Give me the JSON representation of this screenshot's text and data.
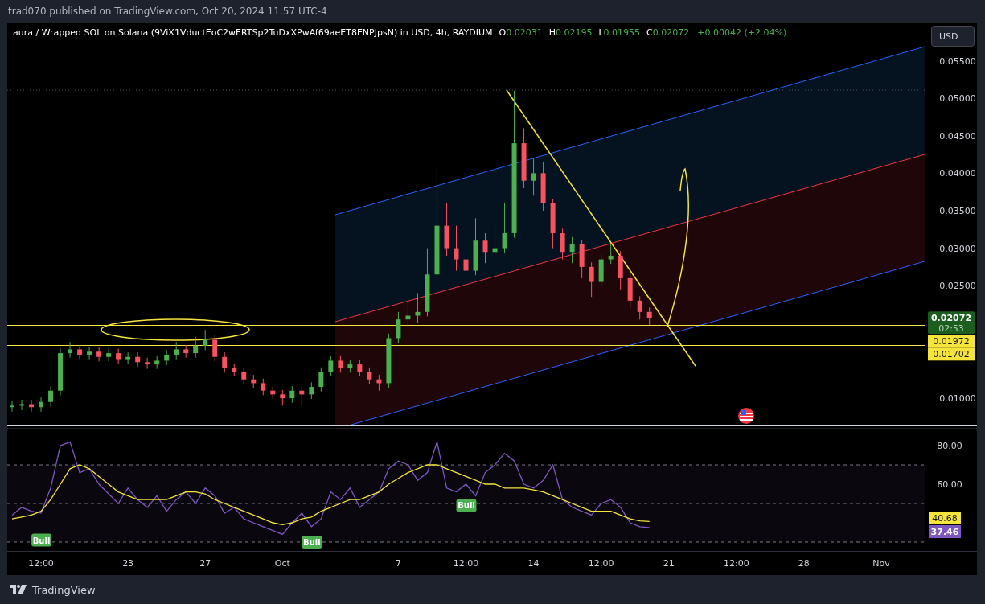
{
  "publish_line": "trad070 published on TradingView.com, Oct 20, 2024 11:57 UTC-4",
  "legend": {
    "title": "aura / Wrapped SOL on Solana (9ViX1VductEoC2wERTSp2TuDxXPwAf69aeET8ENPJpsN) in USD, 4h, RAYDIUM",
    "values": [
      {
        "key": "O",
        "value": "0.02031"
      },
      {
        "key": "H",
        "value": "0.02195"
      },
      {
        "key": "L",
        "value": "0.01955"
      },
      {
        "key": "C",
        "value": "0.02072"
      }
    ],
    "change": "+0.00042 (+2.04%)"
  },
  "currency_button": "USD",
  "price_chart": {
    "chart_data": {
      "type": "candlestick",
      "ylim": [
        0.00625,
        0.0601
      ],
      "categories": [
        null,
        null,
        null,
        null,
        null,
        null,
        null,
        null,
        null,
        null,
        null,
        null,
        null,
        null,
        null,
        null,
        null,
        null,
        null,
        null,
        null,
        null,
        null,
        null,
        null,
        null,
        null,
        null,
        null,
        null,
        null,
        null,
        null,
        null,
        null,
        null,
        null,
        null,
        null,
        null,
        null,
        null,
        null,
        null,
        null,
        null,
        null,
        null,
        null,
        null,
        null,
        null,
        null,
        null,
        null,
        null,
        null,
        null,
        null,
        null,
        null,
        null,
        null,
        null,
        null,
        null,
        null,
        null,
        null,
        null,
        null,
        null,
        null,
        null,
        null,
        null,
        null,
        null,
        null,
        null,
        null,
        null,
        null,
        null,
        null,
        null,
        null,
        null,
        null,
        null,
        null,
        null,
        null,
        null,
        null
      ],
      "ohlc": [
        [
          0.0088,
          0.0096,
          0.0082,
          0.009
        ],
        [
          0.009,
          0.0098,
          0.0084,
          0.0092
        ],
        [
          0.0092,
          0.0098,
          0.0082,
          0.0088
        ],
        [
          0.0088,
          0.0101,
          0.0082,
          0.0095
        ],
        [
          0.0095,
          0.0116,
          0.0089,
          0.011
        ],
        [
          0.011,
          0.0166,
          0.0104,
          0.016
        ],
        [
          0.016,
          0.0175,
          0.0154,
          0.0165
        ],
        [
          0.0165,
          0.0171,
          0.0152,
          0.0158
        ],
        [
          0.0158,
          0.0168,
          0.0152,
          0.0162
        ],
        [
          0.0162,
          0.0168,
          0.0149,
          0.0155
        ],
        [
          0.0155,
          0.0166,
          0.0149,
          0.016
        ],
        [
          0.016,
          0.0166,
          0.0146,
          0.0152
        ],
        [
          0.0152,
          0.0161,
          0.0146,
          0.0155
        ],
        [
          0.0155,
          0.0161,
          0.0142,
          0.0148
        ],
        [
          0.0148,
          0.0154,
          0.0139,
          0.0145
        ],
        [
          0.0145,
          0.0156,
          0.0139,
          0.015
        ],
        [
          0.015,
          0.0164,
          0.0144,
          0.0158
        ],
        [
          0.0158,
          0.0175,
          0.0152,
          0.0165
        ],
        [
          0.0165,
          0.0171,
          0.0154,
          0.016
        ],
        [
          0.016,
          0.0182,
          0.0154,
          0.017
        ],
        [
          0.017,
          0.0191,
          0.0164,
          0.0178
        ],
        [
          0.0178,
          0.0184,
          0.0149,
          0.0155
        ],
        [
          0.0155,
          0.0161,
          0.0134,
          0.014
        ],
        [
          0.014,
          0.0146,
          0.0129,
          0.0135
        ],
        [
          0.0135,
          0.0141,
          0.0119,
          0.0125
        ],
        [
          0.0125,
          0.0131,
          0.0114,
          0.012
        ],
        [
          0.012,
          0.0126,
          0.0104,
          0.011
        ],
        [
          0.011,
          0.0116,
          0.0099,
          0.0105
        ],
        [
          0.0105,
          0.0111,
          0.009,
          0.01
        ],
        [
          0.01,
          0.0116,
          0.0094,
          0.011
        ],
        [
          0.011,
          0.0116,
          0.009,
          0.0105
        ],
        [
          0.0105,
          0.0121,
          0.0099,
          0.0115
        ],
        [
          0.0115,
          0.0141,
          0.0109,
          0.0135
        ],
        [
          0.0135,
          0.0156,
          0.0129,
          0.015
        ],
        [
          0.015,
          0.0156,
          0.0134,
          0.014
        ],
        [
          0.014,
          0.0151,
          0.0134,
          0.0145
        ],
        [
          0.0145,
          0.0151,
          0.0129,
          0.0135
        ],
        [
          0.0135,
          0.0141,
          0.0119,
          0.0125
        ],
        [
          0.0125,
          0.0131,
          0.011,
          0.012
        ],
        [
          0.012,
          0.0186,
          0.0114,
          0.018
        ],
        [
          0.018,
          0.0215,
          0.0174,
          0.0205
        ],
        [
          0.0205,
          0.023,
          0.0195,
          0.021
        ],
        [
          0.021,
          0.024,
          0.02,
          0.0215
        ],
        [
          0.0215,
          0.03,
          0.0209,
          0.0265
        ],
        [
          0.0265,
          0.041,
          0.0259,
          0.033
        ],
        [
          0.033,
          0.036,
          0.029,
          0.03
        ],
        [
          0.03,
          0.033,
          0.027,
          0.0285
        ],
        [
          0.0285,
          0.03,
          0.0255,
          0.027
        ],
        [
          0.027,
          0.034,
          0.0264,
          0.031
        ],
        [
          0.031,
          0.032,
          0.028,
          0.0295
        ],
        [
          0.0295,
          0.033,
          0.0285,
          0.03
        ],
        [
          0.03,
          0.036,
          0.0294,
          0.032
        ],
        [
          0.032,
          0.051,
          0.0314,
          0.044
        ],
        [
          0.044,
          0.046,
          0.038,
          0.039
        ],
        [
          0.039,
          0.042,
          0.037,
          0.04
        ],
        [
          0.04,
          0.0415,
          0.035,
          0.036
        ],
        [
          0.036,
          0.0366,
          0.03,
          0.032
        ],
        [
          0.032,
          0.0326,
          0.0285,
          0.0295
        ],
        [
          0.0295,
          0.0315,
          0.028,
          0.0305
        ],
        [
          0.0305,
          0.0311,
          0.026,
          0.0275
        ],
        [
          0.0275,
          0.0281,
          0.0235,
          0.0255
        ],
        [
          0.0255,
          0.0291,
          0.0249,
          0.0285
        ],
        [
          0.0285,
          0.0305,
          0.0279,
          0.029
        ],
        [
          0.029,
          0.0296,
          0.0245,
          0.026
        ],
        [
          0.026,
          0.0266,
          0.022,
          0.023
        ],
        [
          0.023,
          0.0236,
          0.0205,
          0.0215
        ],
        [
          0.0215,
          0.0221,
          0.0198,
          0.0207
        ],
        null,
        null,
        null,
        null,
        null,
        null,
        null,
        null,
        null,
        null,
        null,
        null,
        null,
        null,
        null,
        null,
        null,
        null,
        null,
        null,
        null,
        null,
        null,
        null,
        null,
        null,
        null,
        null
      ],
      "yticks": [
        {
          "value": 0.01,
          "label": "0.01000"
        },
        {
          "value": 0.025,
          "label": "0.02500"
        },
        {
          "value": 0.03,
          "label": "0.03000"
        },
        {
          "value": 0.035,
          "label": "0.03500"
        },
        {
          "value": 0.04,
          "label": "0.04000"
        },
        {
          "value": 0.045,
          "label": "0.04500"
        },
        {
          "value": 0.05,
          "label": "0.05000"
        },
        {
          "value": 0.055,
          "label": "0.05500"
        }
      ]
    },
    "last_price": {
      "text": "0.02072",
      "countdown": "02:53"
    },
    "horizontal_lines": [
      {
        "label": "0.01972"
      },
      {
        "label": "0.01702"
      }
    ]
  },
  "rsi": {
    "chart_data": {
      "type": "line",
      "ylim": [
        25.4,
        89.2
      ],
      "categories": [
        null,
        null,
        null,
        "12:00",
        null,
        null,
        null,
        null,
        null,
        null,
        null,
        null,
        "23",
        null,
        null,
        null,
        null,
        null,
        null,
        null,
        "27",
        null,
        null,
        null,
        null,
        null,
        null,
        null,
        "Oct",
        null,
        null,
        null,
        null,
        null,
        null,
        null,
        null,
        null,
        null,
        null,
        "7",
        null,
        null,
        null,
        null,
        null,
        null,
        "12:00",
        null,
        null,
        null,
        null,
        null,
        null,
        "14",
        null,
        null,
        null,
        null,
        null,
        null,
        "12:00",
        null,
        null,
        null,
        null,
        null,
        null,
        "21",
        null,
        null,
        null,
        null,
        null,
        null,
        "12:00",
        null,
        null,
        null,
        null,
        null,
        null,
        "28",
        null,
        null,
        null,
        null,
        null,
        null,
        null,
        "Nov",
        null,
        null,
        null,
        null
      ],
      "series": [
        {
          "color": "#7e57c2",
          "values": [
            44,
            48,
            46,
            45,
            58,
            80,
            82,
            66,
            68,
            60,
            55,
            50,
            58,
            52,
            48,
            54,
            46,
            52,
            56,
            50,
            58,
            54,
            45,
            48,
            42,
            40,
            38,
            36,
            34,
            40,
            45,
            38,
            42,
            56,
            52,
            58,
            48,
            52,
            56,
            68,
            72,
            70,
            62,
            66,
            82,
            58,
            56,
            60,
            54,
            66,
            70,
            76,
            72,
            60,
            58,
            62,
            70,
            52,
            48,
            46,
            44,
            50,
            52,
            48,
            40,
            38,
            37.5,
            null,
            null,
            null,
            null,
            null,
            null,
            null,
            null,
            null,
            null,
            null,
            null,
            null,
            null,
            null,
            null,
            null,
            null,
            null,
            null,
            null,
            null,
            null,
            null,
            null,
            null,
            null,
            null
          ]
        },
        {
          "color": "#f5e43c",
          "values": [
            42,
            43,
            44,
            46,
            52,
            60,
            68,
            70,
            68,
            64,
            60,
            56,
            54,
            52,
            52,
            52,
            52,
            54,
            56,
            56,
            55,
            52,
            50,
            48,
            46,
            44,
            42,
            40,
            39,
            40,
            42,
            43,
            46,
            48,
            50,
            52,
            52,
            54,
            56,
            60,
            63,
            66,
            68,
            70,
            70,
            68,
            66,
            64,
            62,
            60,
            60,
            58,
            58,
            58,
            57,
            56,
            54,
            52,
            50,
            48,
            46,
            46,
            46,
            44,
            42,
            41,
            40.7,
            null,
            null,
            null,
            null,
            null,
            null,
            null,
            null,
            null,
            null,
            null,
            null,
            null,
            null,
            null,
            null,
            null,
            null,
            null,
            null,
            null,
            null,
            null,
            null,
            null,
            null,
            null,
            null
          ]
        }
      ],
      "yticks": [
        {
          "value": 60,
          "label": "60.00"
        },
        {
          "value": 80,
          "label": "80.00"
        }
      ]
    },
    "signals": [
      {
        "text": "Bull"
      },
      {
        "text": "Bull"
      },
      {
        "text": "Bull"
      }
    ],
    "value_labels": [
      {
        "text": "40.68",
        "color": "#f5e43c"
      },
      {
        "text": "37.46",
        "color": "#7e57c2"
      }
    ]
  },
  "footer": {
    "brand": "TradingView"
  }
}
